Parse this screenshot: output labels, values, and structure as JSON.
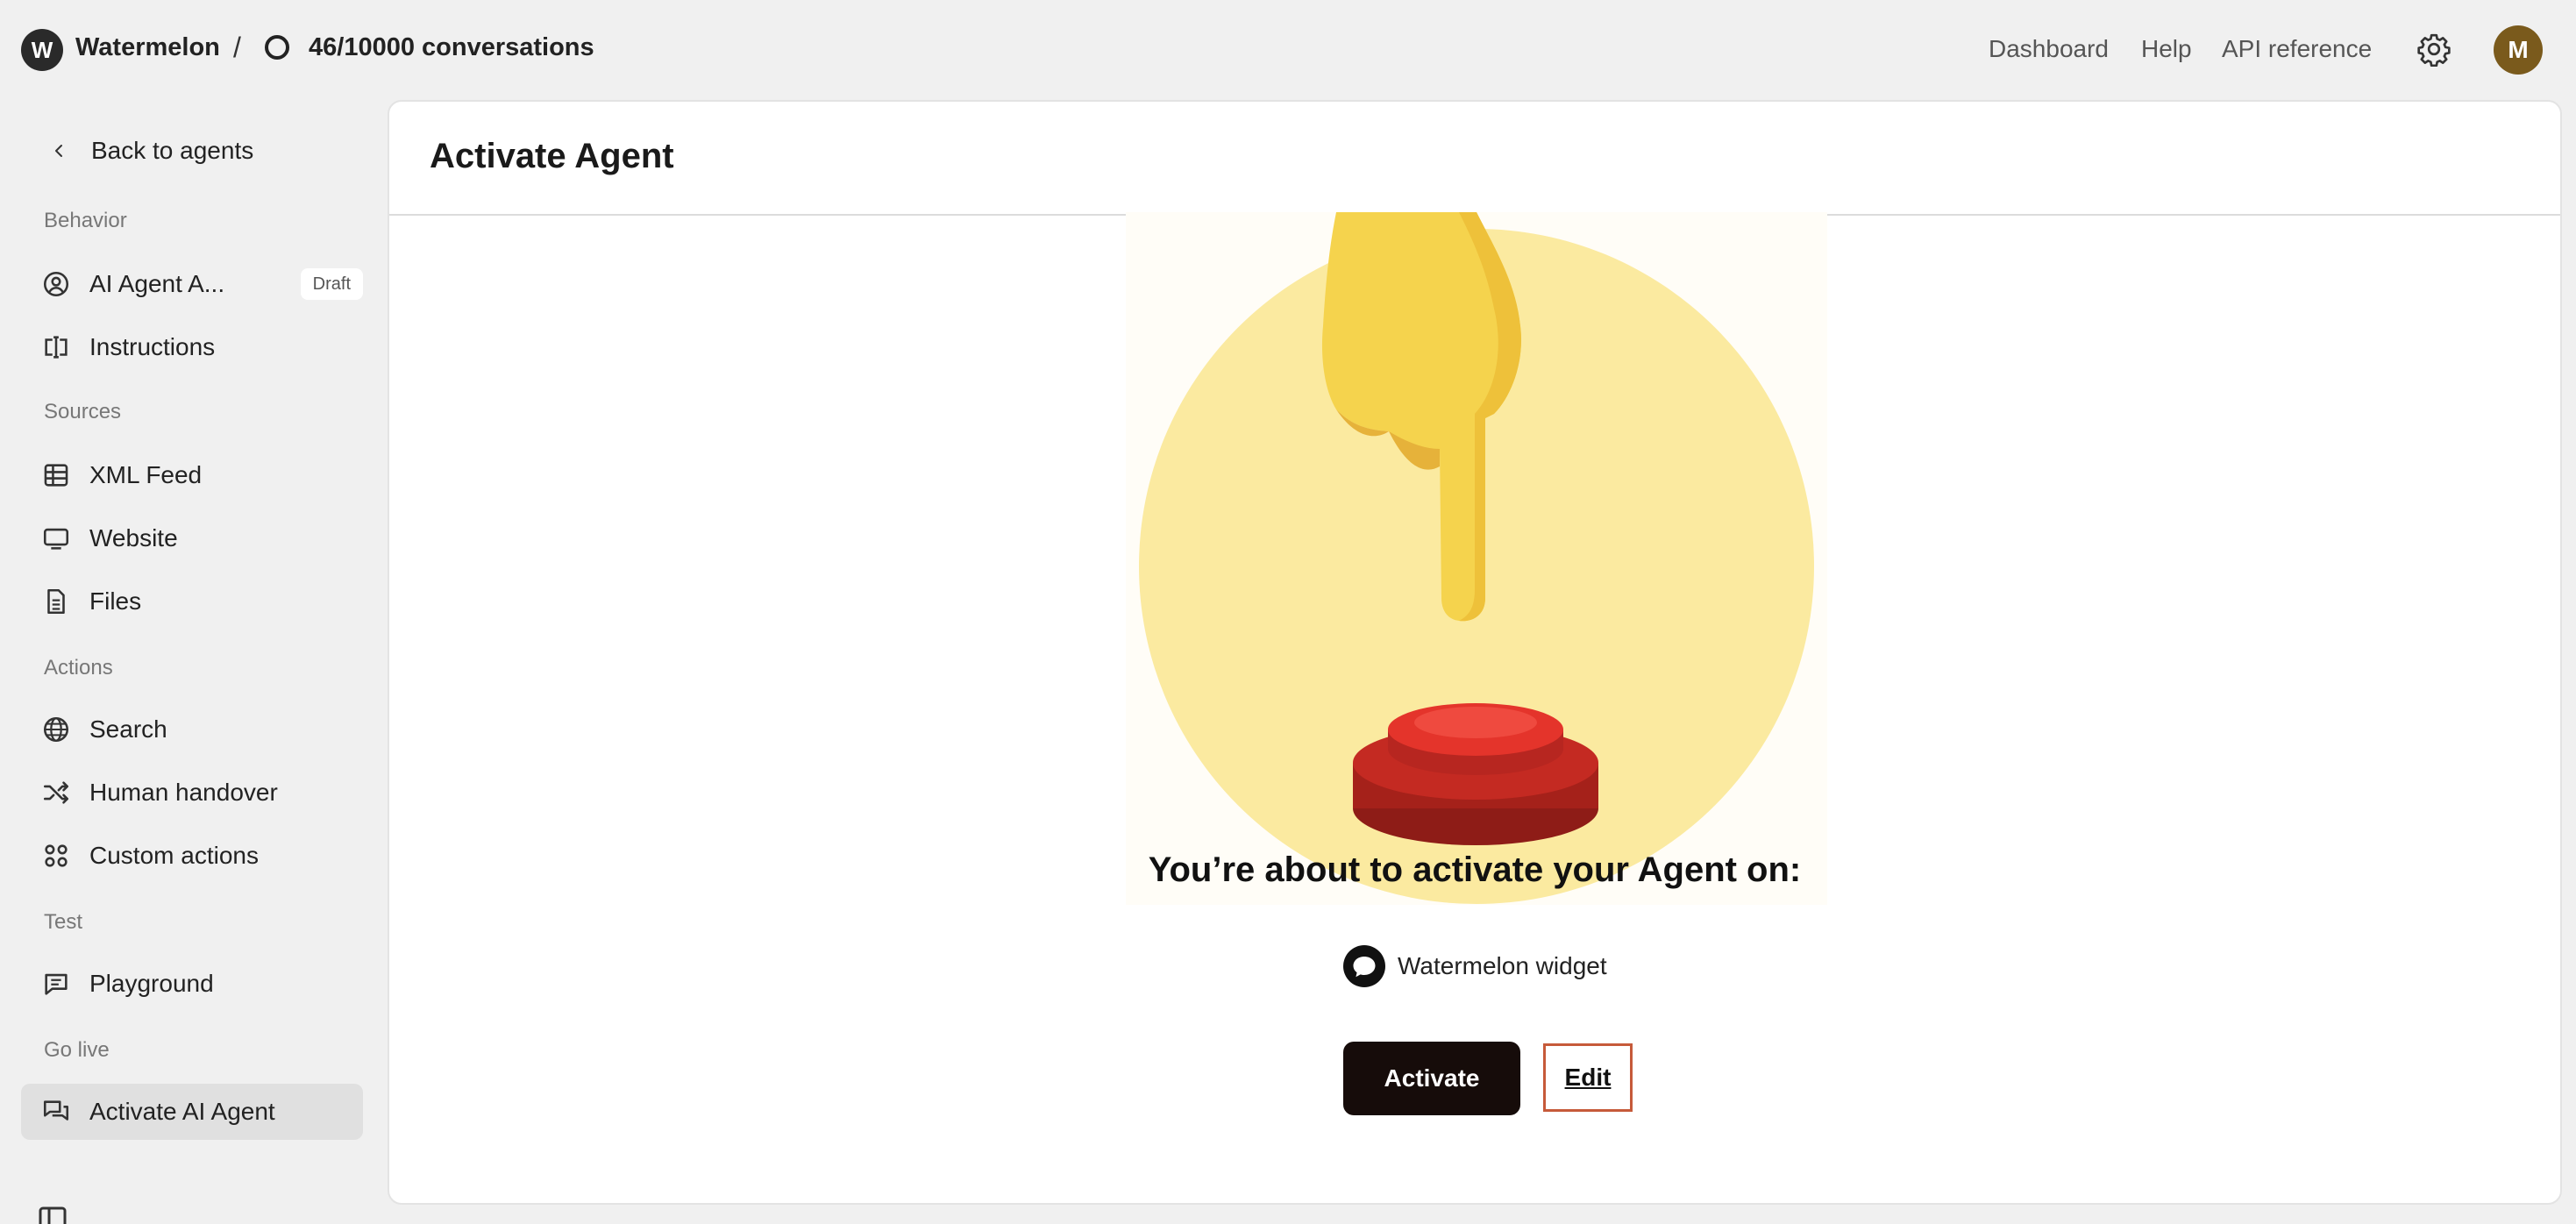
{
  "topbar": {
    "brand": "Watermelon",
    "logo_letter": "W",
    "separator": "/",
    "conversations": "46/10000 conversations",
    "links": [
      "Dashboard",
      "Help",
      "API reference"
    ],
    "avatar_letter": "M"
  },
  "sidebar": {
    "back_label": "Back to agents",
    "sections": [
      {
        "title": "Behavior",
        "items": [
          {
            "label": "AI Agent A...",
            "icon": "user-circle-icon",
            "badge": "Draft"
          },
          {
            "label": "Instructions",
            "icon": "text-cursor-icon"
          }
        ]
      },
      {
        "title": "Sources",
        "items": [
          {
            "label": "XML Feed",
            "icon": "table-icon"
          },
          {
            "label": "Website",
            "icon": "monitor-icon"
          },
          {
            "label": "Files",
            "icon": "file-icon"
          }
        ]
      },
      {
        "title": "Actions",
        "items": [
          {
            "label": "Search",
            "icon": "globe-icon"
          },
          {
            "label": "Human handover",
            "icon": "shuffle-icon"
          },
          {
            "label": "Custom actions",
            "icon": "grid-icon"
          }
        ]
      },
      {
        "title": "Test",
        "items": [
          {
            "label": "Playground",
            "icon": "chat-bubble-icon"
          }
        ]
      },
      {
        "title": "Go live",
        "items": [
          {
            "label": "Activate AI Agent",
            "icon": "chat-bubbles-icon",
            "active": true
          }
        ]
      }
    ]
  },
  "main": {
    "title": "Activate Agent",
    "headline": "You’re about to activate your Agent on:",
    "channel": "Watermelon widget",
    "activate_label": "Activate",
    "edit_label": "Edit"
  }
}
